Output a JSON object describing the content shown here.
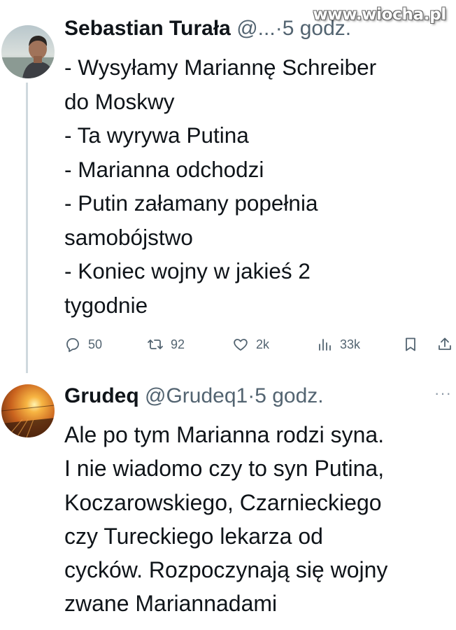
{
  "watermark": "www.wiocha.pl",
  "tweets": [
    {
      "author_name": "Sebastian Turała",
      "handle": "@...",
      "separator": "·",
      "time": "5 godz.",
      "body_lines": [
        "- Wysyłamy Mariannę Schreiber",
        "do Moskwy",
        "- Ta wyrywa Putina",
        "- Marianna odchodzi",
        "- Putin załamany popełnia",
        "samobójstwo",
        "- Koniec wojny w jakieś 2",
        "tygodnie"
      ],
      "replies": "50",
      "retweets": "92",
      "likes": "2k",
      "views": "33k"
    },
    {
      "author_name": "Grudeq",
      "handle": "@Grudeq1",
      "separator": "·",
      "time": "5 godz.",
      "more": "···",
      "body_lines": [
        "Ale po tym Marianna rodzi syna.",
        "I nie wiadomo czy to syn Putina,",
        "Koczarowskiego, Czarnieckiego",
        "czy Tureckiego lekarza od",
        "cycków. Rozpoczynają się wojny",
        "zwane Mariannadami"
      ]
    }
  ],
  "icons": {
    "reply": "reply-icon",
    "retweet": "retweet-icon",
    "like": "like-icon",
    "views": "views-icon",
    "bookmark": "bookmark-icon",
    "share": "share-icon",
    "more": "more-icon"
  },
  "colors": {
    "text": "#0f1419",
    "secondary": "#536471",
    "thread_line": "#cfd9de"
  }
}
